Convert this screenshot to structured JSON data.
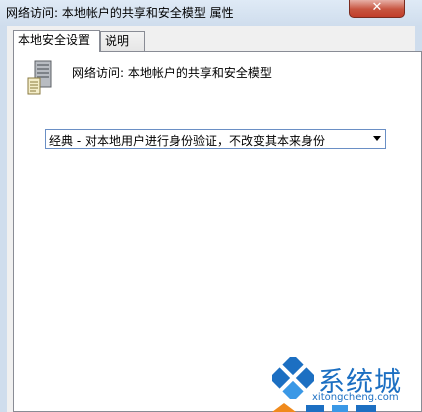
{
  "window": {
    "title": "网络访问: 本地帐户的共享和安全模型 属性",
    "close_label": "✕"
  },
  "tabs": [
    {
      "label": "本地安全设置",
      "active": true
    },
    {
      "label": "说明",
      "active": false
    }
  ],
  "policy": {
    "icon": "server-icon",
    "name": "网络访问: 本地帐户的共享和安全模型"
  },
  "dropdown": {
    "selected": "经典 - 对本地用户进行身份验证，不改变其本来身份"
  },
  "watermark": {
    "brand": "系统城",
    "url": "xitongcheng.com"
  },
  "colors": {
    "watermark_blue": "#1c6fc2",
    "watermark_orange": "#f08a1c",
    "accent_blue": "#6a8fc5"
  }
}
